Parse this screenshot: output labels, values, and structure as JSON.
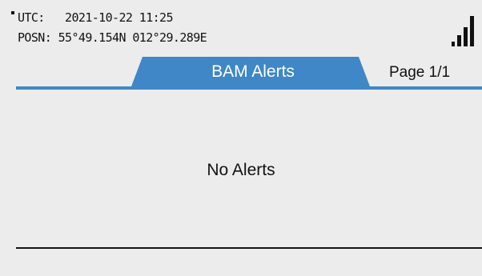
{
  "status": {
    "utc_label": "UTC:",
    "utc_value": "2021-10-22 11:25",
    "posn_label": "POSN:",
    "posn_value": "55°49.154N 012°29.289E",
    "signal_icon": "signal-strength-icon",
    "signal_bars": 4
  },
  "tabs": [
    {
      "label": "BAM Alerts",
      "active": true
    }
  ],
  "pagination": {
    "label": "Page 1/1"
  },
  "main": {
    "message": "No Alerts"
  },
  "colors": {
    "accent": "#3f87c6",
    "background": "#ececec",
    "text": "#111111"
  }
}
